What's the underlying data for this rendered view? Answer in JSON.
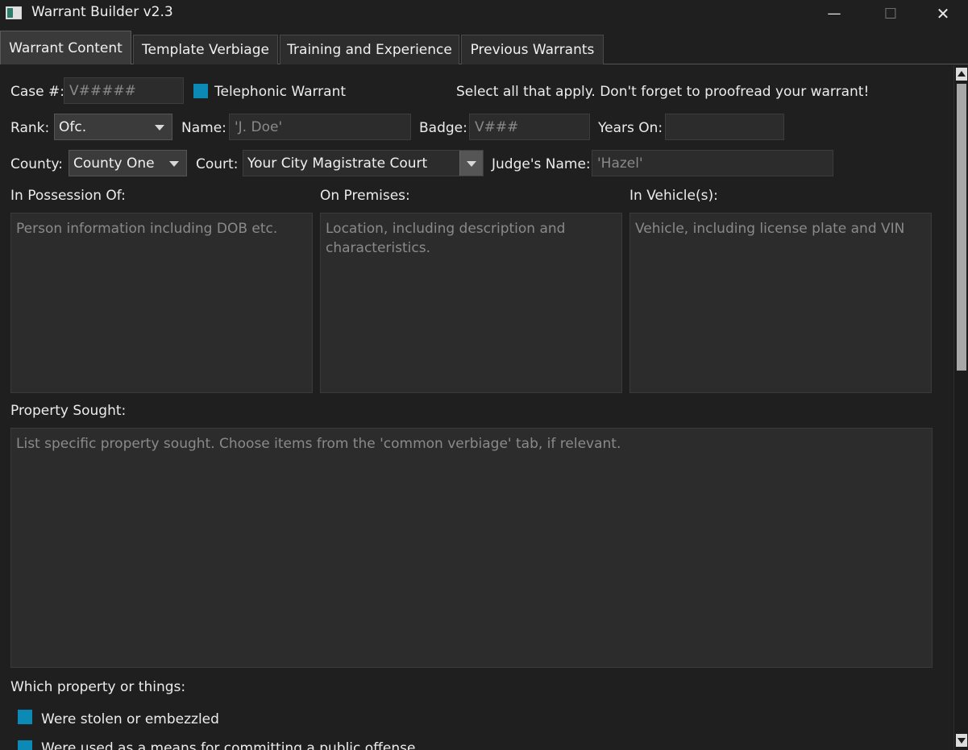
{
  "window": {
    "title": "Warrant Builder v2.3",
    "minimize_glyph": "—",
    "maximize_glyph": "☐",
    "close_glyph": "✕"
  },
  "tabs": [
    {
      "label": "Warrant Content",
      "active": true
    },
    {
      "label": "Template Verbiage"
    },
    {
      "label": "Training and Experience"
    },
    {
      "label": "Previous Warrants"
    }
  ],
  "form": {
    "case_label": "Case #:",
    "case_placeholder": "V#####",
    "telephonic_label": "Telephonic Warrant",
    "instructions": "Select all that apply. Don't forget to proofread your warrant!",
    "rank_label": "Rank:",
    "rank_value": "Ofc.",
    "name_label": "Name:",
    "name_placeholder": "'J. Doe'",
    "badge_label": "Badge:",
    "badge_placeholder": "V###",
    "years_label": "Years On:",
    "years_value": "",
    "county_label": "County:",
    "county_value": "County One",
    "court_label": "Court:",
    "court_value": "Your City Magistrate Court",
    "judge_label": "Judge's Name:",
    "judge_placeholder": "'Hazel'",
    "possession_label": "In Possession Of:",
    "possession_placeholder": "Person information including DOB etc.",
    "premises_label": "On Premises:",
    "premises_placeholder": "Location, including description and characteristics.",
    "vehicle_label": "In Vehicle(s):",
    "vehicle_placeholder": "Vehicle, including license plate and VIN",
    "property_label": "Property Sought:",
    "property_placeholder": "List specific property sought. Choose items from the 'common verbiage' tab, if relevant.",
    "which_label": "Which property or things:",
    "checks": [
      {
        "label": "Were stolen or embezzled"
      },
      {
        "label": "Were used as a means for committing a public offense"
      }
    ]
  },
  "colors": {
    "accent": "#0a8ab5",
    "background": "#1f1f1f",
    "field": "#2c2c2c"
  }
}
